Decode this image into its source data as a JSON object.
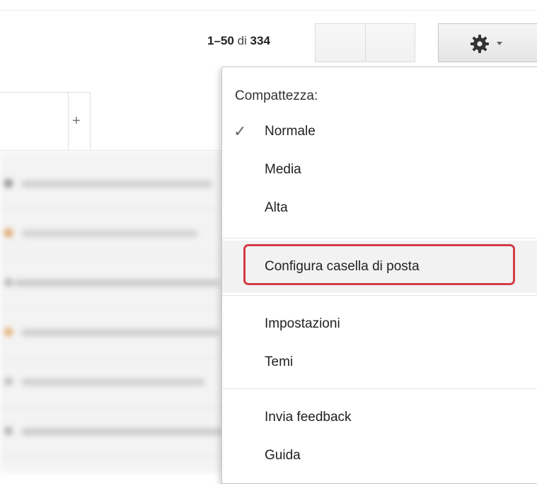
{
  "pagination": {
    "range": "1–50",
    "of_label": "di",
    "total": "334"
  },
  "toolbar": {
    "nav_buttons": [
      "",
      ""
    ],
    "settings_icon": "gear-icon",
    "settings_caret_icon": "chevron-down-icon"
  },
  "tabs": {
    "add_tab_symbol": "+"
  },
  "menu": {
    "heading": "Compattezza:",
    "check_symbol": "✓",
    "density_items": [
      {
        "label": "Normale",
        "checked": true
      },
      {
        "label": "Media",
        "checked": false
      },
      {
        "label": "Alta",
        "checked": false
      }
    ],
    "configure_inbox": "Configura casella di posta",
    "settings": "Impostazioni",
    "themes": "Temi",
    "feedback": "Invia feedback",
    "help": "Guida"
  },
  "colors": {
    "highlight_border": "#d43c45",
    "menu_border": "#c8c8c8",
    "highlight_background": "#f2f2f2"
  }
}
